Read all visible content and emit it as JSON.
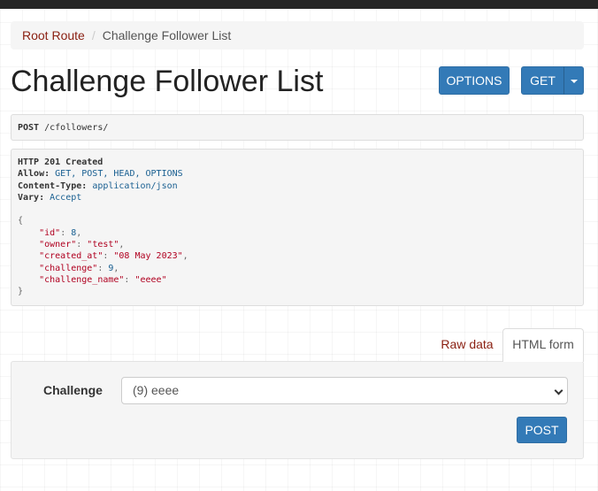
{
  "breadcrumb": {
    "root_label": "Root Route",
    "separator": "/",
    "current_label": "Challenge Follower List"
  },
  "header": {
    "title": "Challenge Follower List",
    "options_label": "OPTIONS",
    "get_label": "GET"
  },
  "request": {
    "method": "POST",
    "path": "/cfollowers/"
  },
  "response": {
    "status_line": "HTTP 201 Created",
    "headers": [
      {
        "name": "Allow:",
        "value": "GET, POST, HEAD, OPTIONS"
      },
      {
        "name": "Content-Type:",
        "value": "application/json"
      },
      {
        "name": "Vary:",
        "value": "Accept"
      }
    ],
    "body": {
      "open": "{",
      "close": "}",
      "fields": [
        {
          "key": "\"id\"",
          "value": "8",
          "type": "num",
          "comma": ","
        },
        {
          "key": "\"owner\"",
          "value": "\"test\"",
          "type": "str",
          "comma": ","
        },
        {
          "key": "\"created_at\"",
          "value": "\"08 May 2023\"",
          "type": "str",
          "comma": ","
        },
        {
          "key": "\"challenge\"",
          "value": "9",
          "type": "num",
          "comma": ","
        },
        {
          "key": "\"challenge_name\"",
          "value": "\"eeee\"",
          "type": "str",
          "comma": ""
        }
      ]
    }
  },
  "tabs": {
    "raw_label": "Raw data",
    "html_label": "HTML form",
    "active": "HTML form"
  },
  "form": {
    "challenge_label": "Challenge",
    "challenge_selected": "(9) eeee",
    "submit_label": "POST"
  },
  "colors": {
    "primary_button": "#337ab7",
    "link": "#8a1f11",
    "topbar": "#262626"
  },
  "icons": {
    "dropdown_caret": "caret-down-icon",
    "select_chevron": "chevron-down-icon"
  }
}
